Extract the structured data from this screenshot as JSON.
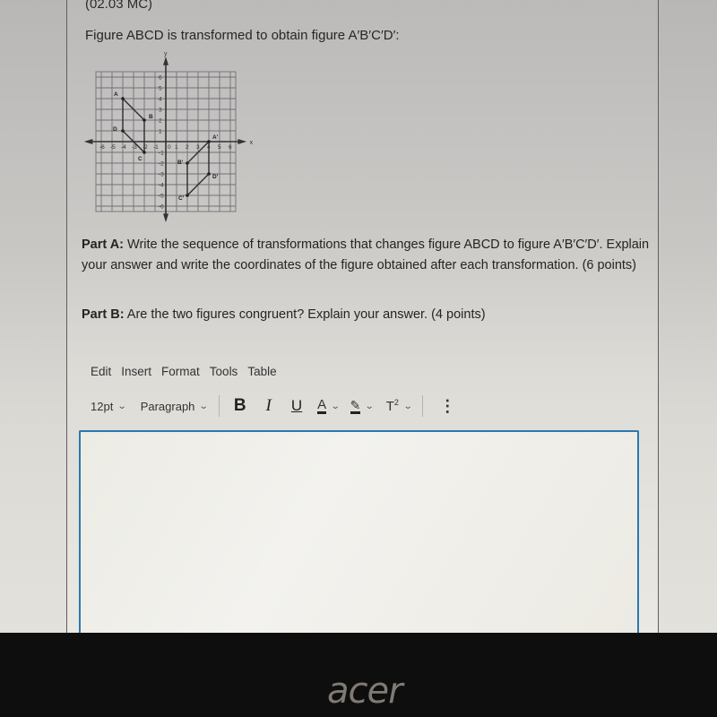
{
  "question": {
    "code": "(02.03 MC)",
    "intro": "Figure ABCD is transformed to obtain figure A′B′C′D′:",
    "partA_label": "Part A:",
    "partA_text": " Write the sequence of transformations that changes figure ABCD to figure A′B′C′D′. Explain your answer and write the coordinates of the figure obtained after each transformation. (6 points)",
    "partB_label": "Part B:",
    "partB_text": " Are the two figures congruent? Explain your answer. (4 points)"
  },
  "graph": {
    "axis_labels": {
      "x": "x",
      "y": "y"
    },
    "range": {
      "xmin": -6,
      "xmax": 6,
      "ymin": -6,
      "ymax": 6
    },
    "x_tick_labels": [
      "-6",
      "-5",
      "-4",
      "-3",
      "-2",
      "-1",
      "0",
      "1",
      "2",
      "3",
      "4",
      "5",
      "6"
    ],
    "y_tick_labels": [
      "6",
      "5",
      "4",
      "3",
      "2",
      "1",
      "-1",
      "-2",
      "-3",
      "-4",
      "-5",
      "-6"
    ],
    "figures": [
      {
        "name": "ABCD",
        "points": [
          {
            "label": "A",
            "x": -4,
            "y": 4
          },
          {
            "label": "B",
            "x": -2,
            "y": 2
          },
          {
            "label": "C",
            "x": -2,
            "y": -1
          },
          {
            "label": "D",
            "x": -4,
            "y": 1
          }
        ]
      },
      {
        "name": "A'B'C'D'",
        "points": [
          {
            "label": "A'",
            "x": 4,
            "y": 0
          },
          {
            "label": "B'",
            "x": 2,
            "y": -2
          },
          {
            "label": "C'",
            "x": 2,
            "y": -5
          },
          {
            "label": "D'",
            "x": 4,
            "y": -3
          }
        ]
      }
    ]
  },
  "editor": {
    "menu": [
      "Edit",
      "Insert",
      "Format",
      "Tools",
      "Table"
    ],
    "font_size": "12pt",
    "block_format": "Paragraph",
    "bold": "B",
    "italic": "I",
    "underline": "U",
    "text_color": "A",
    "highlight": "✎",
    "superscript": "T",
    "superscript_mark": "2",
    "more": "⋮",
    "content": ""
  },
  "device": {
    "brand": "acer"
  },
  "colors": {
    "editor_border": "#2a78b0"
  }
}
